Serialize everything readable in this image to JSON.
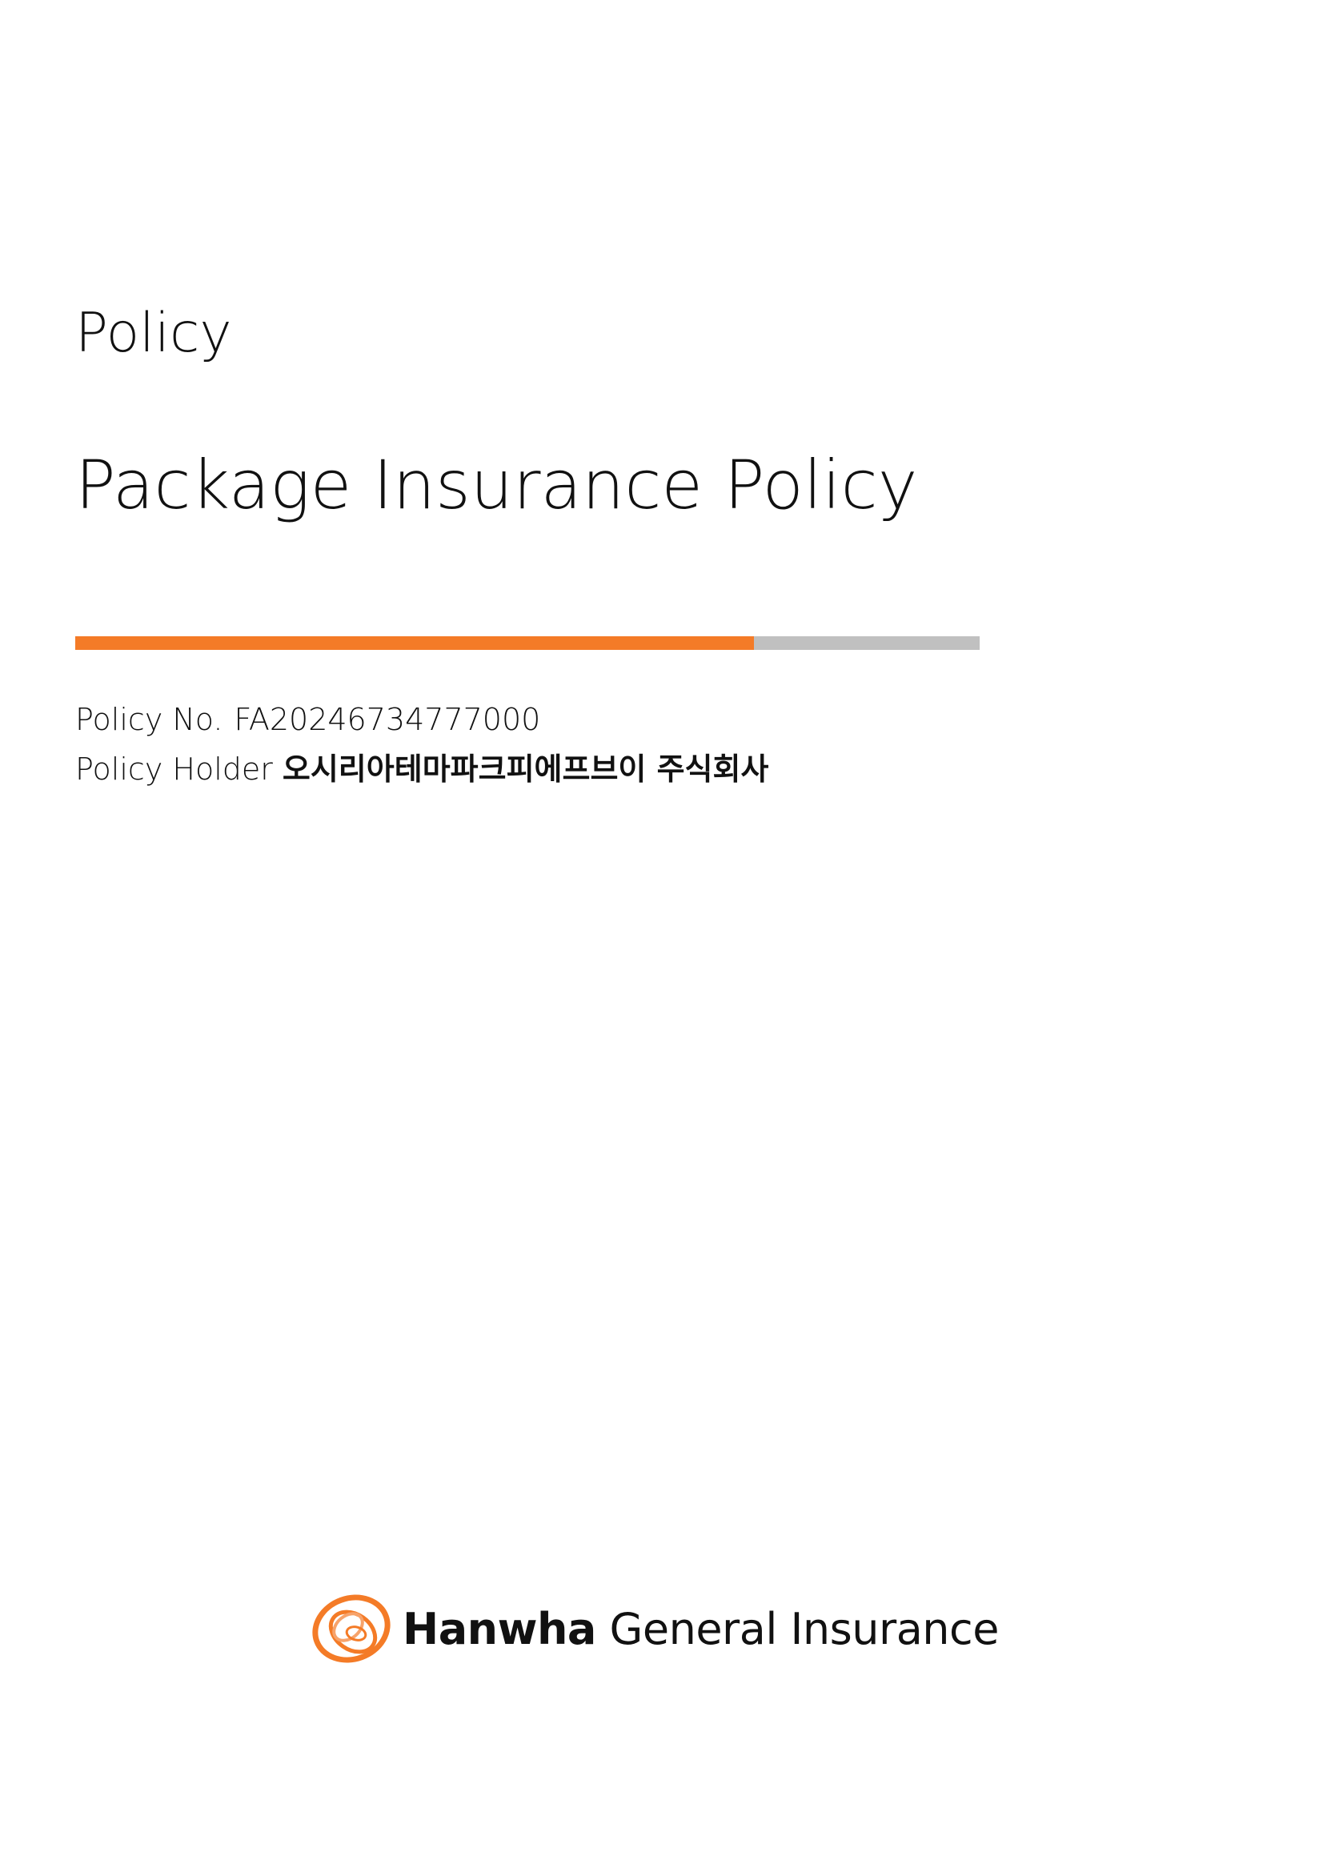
{
  "document": {
    "label": "Policy",
    "title": "Package Insurance Policy"
  },
  "accent_bar": {
    "fill_fraction": 0.75,
    "fill_color": "#f47b27",
    "track_color": "#c0c0c0"
  },
  "info": {
    "policy_no_label": "Policy No.",
    "policy_no_value": "FA20246734777000",
    "holder_label": "Policy Holder",
    "holder_value": "오시리아테마파크피에프브이 주식회사"
  },
  "logo": {
    "icon": "hanwha-swirl-icon",
    "brand": "Hanwha",
    "rest": "General Insurance",
    "color": "#f47b27"
  }
}
